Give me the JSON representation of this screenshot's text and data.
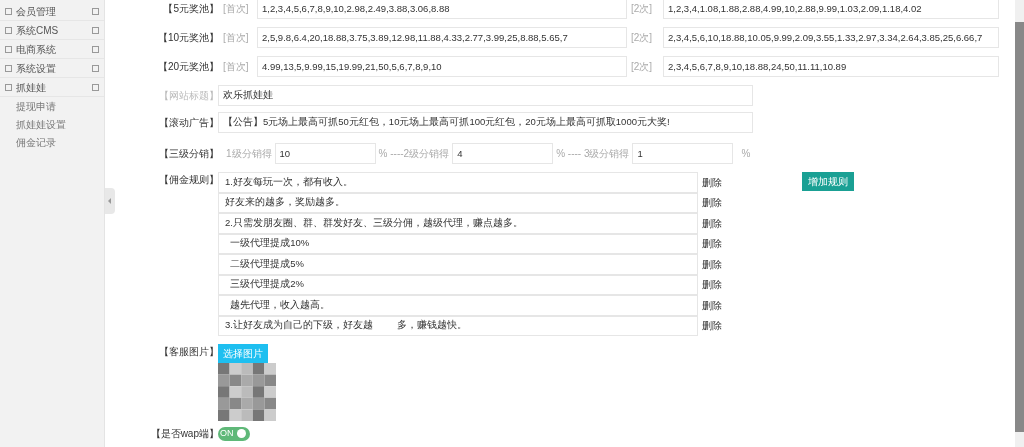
{
  "sidebar": {
    "items": [
      {
        "label": "会员管理"
      },
      {
        "label": "系统CMS"
      },
      {
        "label": "电商系统"
      },
      {
        "label": "系统设置"
      },
      {
        "label": "抓娃娃",
        "children": [
          {
            "label": "提现申请"
          },
          {
            "label": "抓娃娃设置"
          },
          {
            "label": "佣金记录"
          }
        ]
      }
    ]
  },
  "prize_pools": [
    {
      "label": "【5元奖池】",
      "first_tag": "[首次]",
      "first_value": "1,2,3,4,5,6,7,8,9,10,2.98,2.49,3.88,3.06,8.88",
      "second_tag": "[2次]",
      "second_value": "1,2,3,4,1.08,1.88,2.88,4.99,10,2.88,9.99,1.03,2.09,1.18,4.02"
    },
    {
      "label": "【10元奖池】",
      "first_tag": "[首次]",
      "first_value": "2,5,9.8,6.4,20,18.88,3.75,3.89,12.98,11.88,4.33,2.77,3.99,25,8.88,5.65,7",
      "second_tag": "[2次]",
      "second_value": "2,3,4,5,6,10,18.88,10.05,9.99,2.09,3.55,1.33,2.97,3.34,2.64,3.85,25,6.66,7"
    },
    {
      "label": "【20元奖池】",
      "first_tag": "[首次]",
      "first_value": "4.99,13,5,9.99,15,19.99,21,50,5,6,7,8,9,10",
      "second_tag": "[2次]",
      "second_value": "2,3,4,5,6,7,8,9,10,18.88,24,50,11.11,10.89"
    }
  ],
  "site_title": {
    "label": "【网站标题】",
    "value": "欢乐抓娃娃"
  },
  "scroll_ad": {
    "label": "【滚动广告】",
    "value": "【公告】5元场上最高可抓50元红包，10元场上最高可抓100元红包，20元场上最高可抓取1000元大奖!"
  },
  "distribution": {
    "label": "【三级分销】",
    "levels": [
      {
        "prefix": "1级分销得",
        "value": "10"
      },
      {
        "prefix": "% ----2级分销得",
        "value": "4"
      },
      {
        "prefix": "% ---- 3级分销得",
        "value": "1"
      }
    ],
    "suffix": "%"
  },
  "commission_rules": {
    "label": "【佣金规则】",
    "rules": [
      {
        "value": "1.好友每玩一次，都有收入。",
        "delete": "删除"
      },
      {
        "value": "好友来的越多，奖励越多。",
        "delete": "删除"
      },
      {
        "value": "2.只需发朋友圈、群、群发好友、三级分佣，越级代理，赚点越多。",
        "delete": "删除"
      },
      {
        "value": "  一级代理提成10%",
        "delete": "删除"
      },
      {
        "value": "  二级代理提成5%",
        "delete": "删除"
      },
      {
        "value": "  三级代理提成2%",
        "delete": "删除"
      },
      {
        "value": "  越先代理，收入越高。",
        "delete": "删除"
      },
      {
        "value": "3.让好友成为自己的下级，好友越         多，赚钱越快。",
        "delete": "删除"
      }
    ],
    "add_button": "增加规则"
  },
  "service_image": {
    "label": "【客服图片】",
    "button": "选择图片"
  },
  "wap": {
    "label": "【是否wap端】",
    "on": true,
    "on_text": "ON"
  }
}
